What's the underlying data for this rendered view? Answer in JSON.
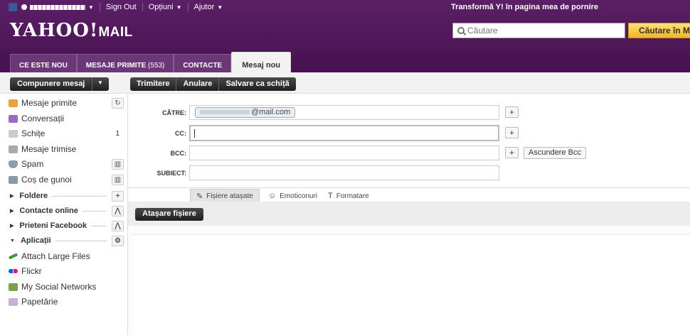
{
  "topbar": {
    "sign_out": "Sign Out",
    "options": "Opțiuni",
    "help": "Ajutor",
    "promo": "Transformă Y! în pagina mea de pornire"
  },
  "logo": {
    "brand": "YAHOO!",
    "product": "MAIL"
  },
  "search": {
    "placeholder": "Căutare",
    "button": "Căutare în M"
  },
  "tabs": [
    {
      "label": "CE ESTE NOU"
    },
    {
      "label": "MESAJE PRIMITE",
      "count": "(553)"
    },
    {
      "label": "CONTACTE"
    },
    {
      "label": "Mesaj nou"
    }
  ],
  "compose": {
    "label": "Compunere mesaj"
  },
  "actions": [
    "Trimitere",
    "Anulare",
    "Salvare ca schiță"
  ],
  "sidebar": {
    "folders": [
      {
        "label": "Mesaje primite",
        "icon": "inbox-icon",
        "color": "#e8a040"
      },
      {
        "label": "Conversații",
        "icon": "conversations-icon",
        "color": "#9b6bc4"
      },
      {
        "label": "Schițe",
        "icon": "drafts-icon",
        "count": "1",
        "color": "#aaaaaa"
      },
      {
        "label": "Mesaje trimise",
        "icon": "sent-icon",
        "color": "#999999"
      },
      {
        "label": "Spam",
        "icon": "shield-icon",
        "color": "#8aa0b0"
      },
      {
        "label": "Coș de gunoi",
        "icon": "trash-icon",
        "color": "#8899aa"
      }
    ],
    "sections": [
      "Foldere",
      "Contacte online",
      "Prieteni Facebook",
      "Aplicații"
    ],
    "apps": [
      {
        "label": "Attach Large Files",
        "icon": "paperclip-icon",
        "color": "#3a9a3a"
      },
      {
        "label": "Flickr",
        "icon": "flickr-icon",
        "color": "#e0338d"
      },
      {
        "label": "My Social Networks",
        "icon": "social-icon",
        "color": "#7aa04a"
      },
      {
        "label": "Papetărie",
        "icon": "stationery-icon",
        "color": "#c8b0d8"
      }
    ]
  },
  "form": {
    "to_label": "CĂTRE:",
    "to_value": "@mail.com",
    "cc_label": "CC:",
    "bcc_label": "BCC:",
    "subject_label": "SUBIECT:",
    "hide_bcc": "Ascundere Bcc",
    "plus": "+"
  },
  "subtabs": [
    "Fișiere atașate",
    "Emoticonuri",
    "Formatare"
  ],
  "attach_button": "Atașare fișiere"
}
